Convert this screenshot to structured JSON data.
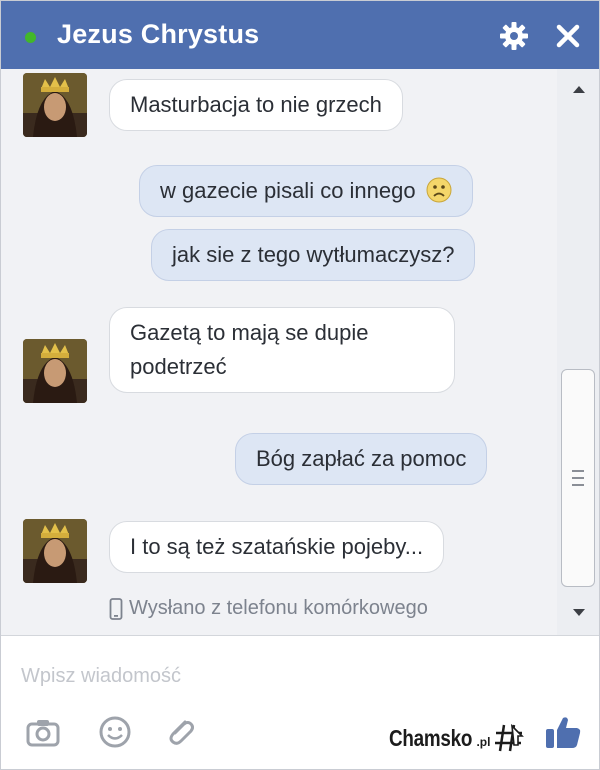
{
  "header": {
    "title": "Jezus Chrystus",
    "status_color": "#42b72a",
    "bar_color": "#4f6faf",
    "icons": [
      "gear-icon",
      "close-icon"
    ]
  },
  "messages": [
    {
      "sender": "contact",
      "text": "Masturbacja to nie grzech"
    },
    {
      "sender": "me",
      "text": "w gazecie pisali co innego",
      "emoji": "frown-emoji"
    },
    {
      "sender": "me",
      "text": "jak sie z tego wytłumaczysz?"
    },
    {
      "sender": "contact",
      "lines": [
        "Gazetą to mają se dupie",
        "podetrzeć"
      ]
    },
    {
      "sender": "me",
      "text": "Bóg zapłać za pomoc"
    },
    {
      "sender": "contact",
      "text": "I to są też szatańskie pojeby..."
    }
  ],
  "sent_info": "Wysłano z telefonu komórkowego",
  "composer": {
    "placeholder": "Wpisz wiadomość",
    "icons": [
      "camera-icon",
      "emoji-icon",
      "attachment-icon",
      "like-icon"
    ]
  },
  "watermark": {
    "text": "Chamsko",
    "suffix": ".pl"
  },
  "colors": {
    "incoming_bubble": "#ffffff",
    "outgoing_bubble": "#dde6f4"
  }
}
